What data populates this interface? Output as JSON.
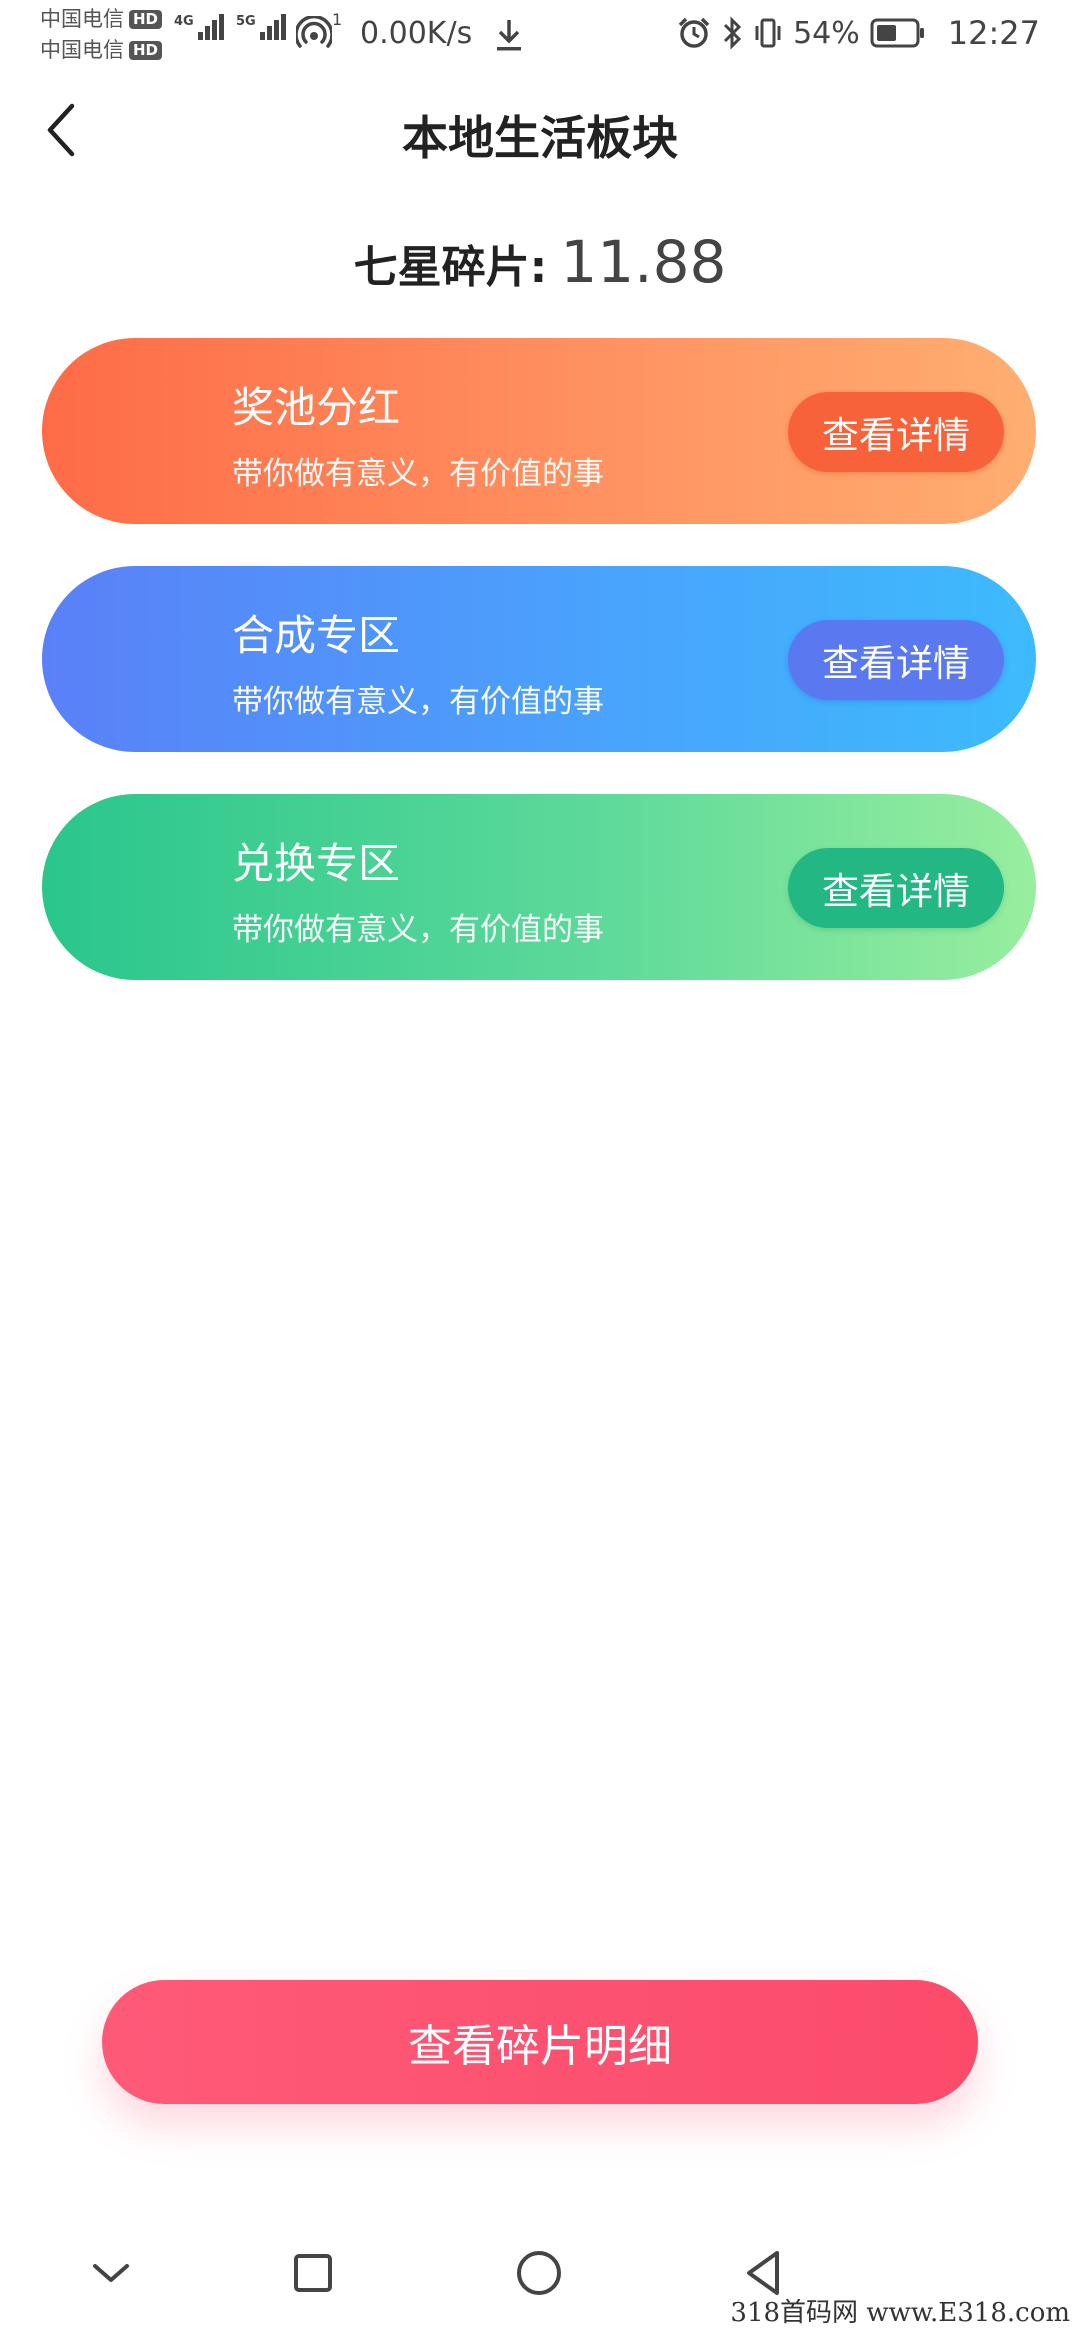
{
  "status_bar": {
    "carrier_1": "中国电信",
    "carrier_2": "中国电信",
    "hd_label": "HD",
    "network_1": "4G",
    "network_2": "5G",
    "hotspot_count": "1",
    "net_speed": "0.00K/s",
    "battery_percent": "54%",
    "battery_level": 0.54,
    "time": "12:27"
  },
  "header": {
    "title": "本地生活板块"
  },
  "balance": {
    "label": "七星碎片:",
    "value": "11.88"
  },
  "cards": [
    {
      "title": "奖池分红",
      "description": "带你做有意义，有价值的事",
      "button_label": "查看详情",
      "color": "#fe6b47"
    },
    {
      "title": "合成专区",
      "description": "带你做有意义，有价值的事",
      "button_label": "查看详情",
      "color": "#5a80f8"
    },
    {
      "title": "兑换专区",
      "description": "带你做有意义，有价值的事",
      "button_label": "查看详情",
      "color": "#2ac68c"
    }
  ],
  "main_button": {
    "label": "查看碎片明细",
    "color": "#fe5a78"
  },
  "nav_bar": {
    "icons": [
      "chevron-down-icon",
      "recent-apps-icon",
      "home-icon",
      "back-triangle-icon"
    ]
  },
  "watermark": {
    "text": "318首码网 www.E318.com"
  }
}
